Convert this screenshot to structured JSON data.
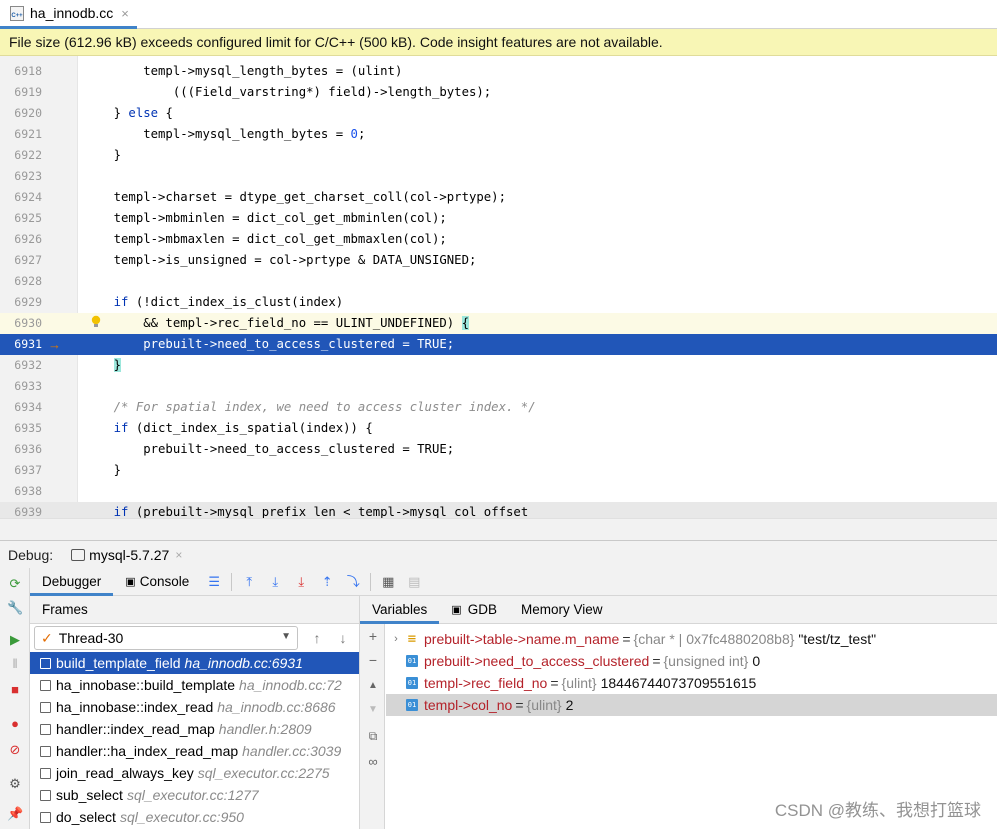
{
  "editor_tab": {
    "file_name": "ha_innodb.cc",
    "close": "×",
    "icon_label": "C++"
  },
  "banner": {
    "text": "File size (612.96 kB) exceeds configured limit for C/C++ (500 kB). Code insight features are not available."
  },
  "code_lines": [
    {
      "n": "6918",
      "code": "        templ->mysql_length_bytes = (ulint)"
    },
    {
      "n": "6919",
      "code": "            (((Field_varstring*) field)->length_bytes);"
    },
    {
      "n": "6920",
      "code": "    } else {"
    },
    {
      "n": "6921",
      "code": "        templ->mysql_length_bytes = 0;"
    },
    {
      "n": "6922",
      "code": "    }"
    },
    {
      "n": "6923",
      "code": ""
    },
    {
      "n": "6924",
      "code": "    templ->charset = dtype_get_charset_coll(col->prtype);"
    },
    {
      "n": "6925",
      "code": "    templ->mbminlen = dict_col_get_mbminlen(col);"
    },
    {
      "n": "6926",
      "code": "    templ->mbmaxlen = dict_col_get_mbmaxlen(col);"
    },
    {
      "n": "6927",
      "code": "    templ->is_unsigned = col->prtype & DATA_UNSIGNED;"
    },
    {
      "n": "6928",
      "code": ""
    },
    {
      "n": "6929",
      "code": "    if (!dict_index_is_clust(index)"
    },
    {
      "n": "6930",
      "code": "        && templ->rec_field_no == ULINT_UNDEFINED) {"
    },
    {
      "n": "6931",
      "code": "        prebuilt->need_to_access_clustered = TRUE;"
    },
    {
      "n": "6932",
      "code": "    }"
    },
    {
      "n": "6933",
      "code": ""
    },
    {
      "n": "6934",
      "code": "    /* For spatial index, we need to access cluster index. */"
    },
    {
      "n": "6935",
      "code": "    if (dict_index_is_spatial(index)) {"
    },
    {
      "n": "6936",
      "code": "        prebuilt->need_to_access_clustered = TRUE;"
    },
    {
      "n": "6937",
      "code": "    }"
    },
    {
      "n": "6938",
      "code": ""
    },
    {
      "n": "6939",
      "code": "    if (prebuilt->mysql_prefix_len < templ->mysql_col_offset"
    }
  ],
  "debug": {
    "title": "Debug:",
    "session": "mysql-5.7.27",
    "session_close": "×",
    "tabs": {
      "debugger": "Debugger",
      "console": "Console"
    },
    "frames_header": "Frames",
    "thread": "Thread-30",
    "frames": [
      {
        "name": "build_template_field",
        "loc": "ha_innodb.cc:6931"
      },
      {
        "name": "ha_innobase::build_template",
        "loc": "ha_innodb.cc:72"
      },
      {
        "name": "ha_innobase::index_read",
        "loc": "ha_innodb.cc:8686"
      },
      {
        "name": "handler::index_read_map",
        "loc": "handler.h:2809"
      },
      {
        "name": "handler::ha_index_read_map",
        "loc": "handler.cc:3039"
      },
      {
        "name": "join_read_always_key",
        "loc": "sql_executor.cc:2275"
      },
      {
        "name": "sub_select",
        "loc": "sql_executor.cc:1277"
      },
      {
        "name": "do_select",
        "loc": "sql_executor.cc:950"
      }
    ],
    "vars_tabs": {
      "variables": "Variables",
      "gdb": "GDB",
      "memory": "Memory View"
    },
    "variables": [
      {
        "name": "prebuilt->table->name.m_name",
        "eq": "=",
        "type": "{char * | 0x7fc4880208b8}",
        "value": "\"test/tz_test\"",
        "icon": "list",
        "expand": "›"
      },
      {
        "name": "prebuilt->need_to_access_clustered",
        "eq": "=",
        "type": "{unsigned int}",
        "value": "0",
        "icon": "01",
        "expand": ""
      },
      {
        "name": "templ->rec_field_no",
        "eq": "=",
        "type": "{ulint}",
        "value": "18446744073709551615",
        "icon": "01",
        "expand": ""
      },
      {
        "name": "templ->col_no",
        "eq": "=",
        "type": "{ulint}",
        "value": "2",
        "icon": "01",
        "expand": ""
      }
    ]
  },
  "watermark": "CSDN @教练、我想打篮球",
  "colors": {
    "selection": "#2156b8",
    "var_name": "#b4222a",
    "banner_bg": "#f8f6b5",
    "keyword": "#0033b3"
  }
}
